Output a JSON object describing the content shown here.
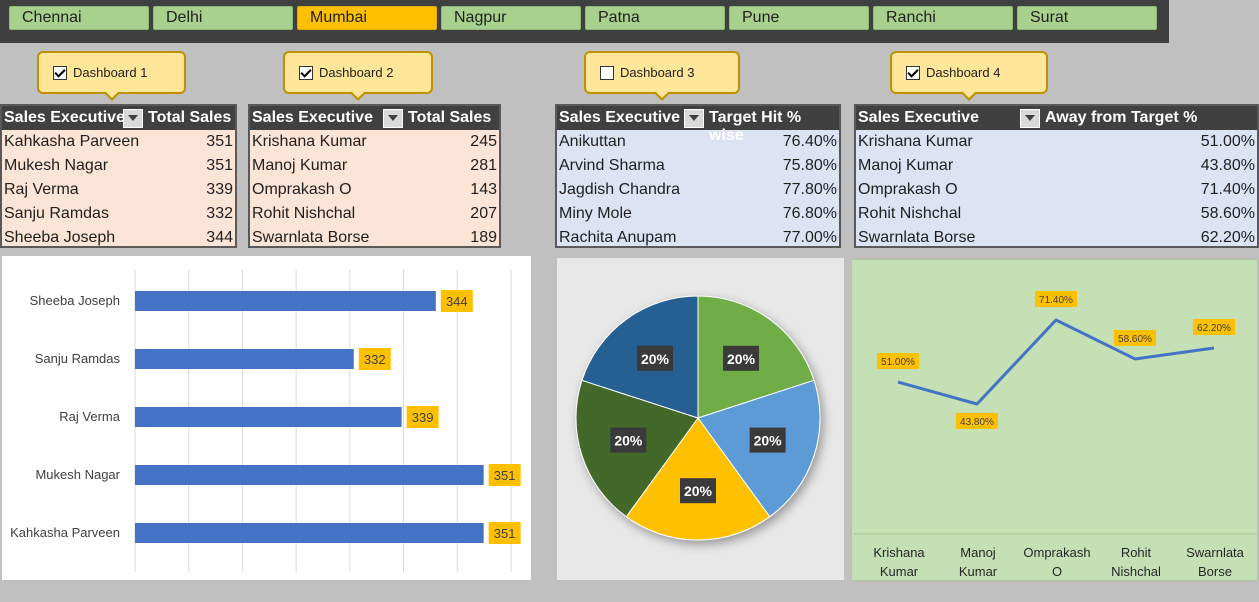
{
  "slicer": {
    "items": [
      "Chennai",
      "Delhi",
      "Mumbai",
      "Nagpur",
      "Patna",
      "Pune",
      "Ranchi",
      "Surat"
    ],
    "selected": "Mumbai"
  },
  "callouts": [
    {
      "label": "Dashboard 1",
      "checked": true
    },
    {
      "label": "Dashboard 2",
      "checked": true
    },
    {
      "label": "Dashboard 3",
      "checked": false
    },
    {
      "label": "Dashboard 4",
      "checked": true
    }
  ],
  "tables": [
    {
      "col1": "Sales Executive",
      "col2": "Total Sales",
      "rows": [
        {
          "name": "Kahkasha Parveen",
          "value": "351"
        },
        {
          "name": "Mukesh Nagar",
          "value": "351"
        },
        {
          "name": "Raj Verma",
          "value": "339"
        },
        {
          "name": "Sanju Ramdas",
          "value": "332"
        },
        {
          "name": "Sheeba Joseph",
          "value": "344"
        }
      ]
    },
    {
      "col1": "Sales Executive",
      "col2": "Total Sales",
      "rows": [
        {
          "name": "Krishana Kumar",
          "value": "245"
        },
        {
          "name": "Manoj Kumar",
          "value": "281"
        },
        {
          "name": "Omprakash O",
          "value": "143"
        },
        {
          "name": "Rohit Nishchal",
          "value": "207"
        },
        {
          "name": "Swarnlata Borse",
          "value": "189"
        }
      ]
    },
    {
      "col1": "Sales Executive",
      "col2": "Target Hit % wise",
      "rows": [
        {
          "name": "Anikuttan",
          "value": "76.40%"
        },
        {
          "name": "Arvind Sharma",
          "value": "75.80%"
        },
        {
          "name": "Jagdish Chandra",
          "value": "77.80%"
        },
        {
          "name": "Miny Mole",
          "value": "76.80%"
        },
        {
          "name": "Rachita Anupam",
          "value": "77.00%"
        }
      ]
    },
    {
      "col1": "Sales Executive",
      "col2": "Away from Target %",
      "rows": [
        {
          "name": "Krishana Kumar",
          "value": "51.00%"
        },
        {
          "name": "Manoj Kumar",
          "value": "43.80%"
        },
        {
          "name": "Omprakash O",
          "value": "71.40%"
        },
        {
          "name": "Rohit Nishchal",
          "value": "58.60%"
        },
        {
          "name": "Swarnlata Borse",
          "value": "62.20%"
        }
      ]
    }
  ],
  "chart_data": [
    {
      "type": "bar",
      "orientation": "horizontal",
      "categories": [
        "Sheeba Joseph",
        "Sanju Ramdas",
        "Raj Verma",
        "Mukesh Nagar",
        "Kahkasha Parveen"
      ],
      "values": [
        344,
        332,
        339,
        351,
        351
      ],
      "data_labels": [
        "344",
        "332",
        "339",
        "351",
        "351"
      ],
      "xlim": [
        300,
        355
      ],
      "grid": true,
      "color": "#4472c4",
      "label_color": "#ffc000"
    },
    {
      "type": "pie",
      "values": [
        20,
        20,
        20,
        20,
        20
      ],
      "data_labels": [
        "20%",
        "20%",
        "20%",
        "20%",
        "20%"
      ],
      "colors": [
        "#70ad47",
        "#5b9bd5",
        "#ffc000",
        "#43682b",
        "#255e91"
      ]
    },
    {
      "type": "line",
      "categories": [
        "Krishana Kumar",
        "Manoj Kumar",
        "Omprakash O",
        "Rohit Nishchal",
        "Swarnlata Borse"
      ],
      "values": [
        51.0,
        43.8,
        71.4,
        58.6,
        62.2
      ],
      "data_labels": [
        "51.00%",
        "43.80%",
        "71.40%",
        "58.60%",
        "62.20%"
      ],
      "color": "#4472c4",
      "background": "#c5e0b4"
    }
  ]
}
